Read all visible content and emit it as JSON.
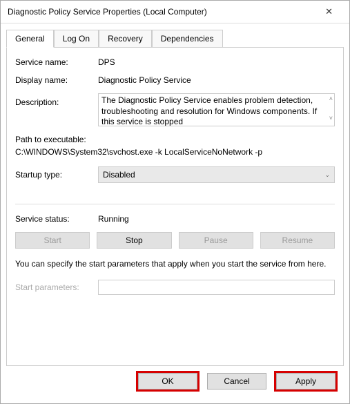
{
  "title": "Diagnostic Policy Service Properties (Local Computer)",
  "tabs": {
    "general": "General",
    "logon": "Log On",
    "recovery": "Recovery",
    "dependencies": "Dependencies"
  },
  "labels": {
    "service_name": "Service name:",
    "display_name": "Display name:",
    "description": "Description:",
    "path_to_exe": "Path to executable:",
    "startup_type": "Startup type:",
    "service_status": "Service status:",
    "start_parameters": "Start parameters:"
  },
  "values": {
    "service_name": "DPS",
    "display_name": "Diagnostic Policy Service",
    "description": "The Diagnostic Policy Service enables problem detection, troubleshooting and resolution for Windows components. If this service is stopped",
    "path_to_exe": "C:\\WINDOWS\\System32\\svchost.exe -k LocalServiceNoNetwork -p",
    "startup_type": "Disabled",
    "service_status": "Running",
    "start_parameters": ""
  },
  "hint": "You can specify the start parameters that apply when you start the service from here.",
  "buttons": {
    "start": "Start",
    "stop": "Stop",
    "pause": "Pause",
    "resume": "Resume",
    "ok": "OK",
    "cancel": "Cancel",
    "apply": "Apply"
  }
}
